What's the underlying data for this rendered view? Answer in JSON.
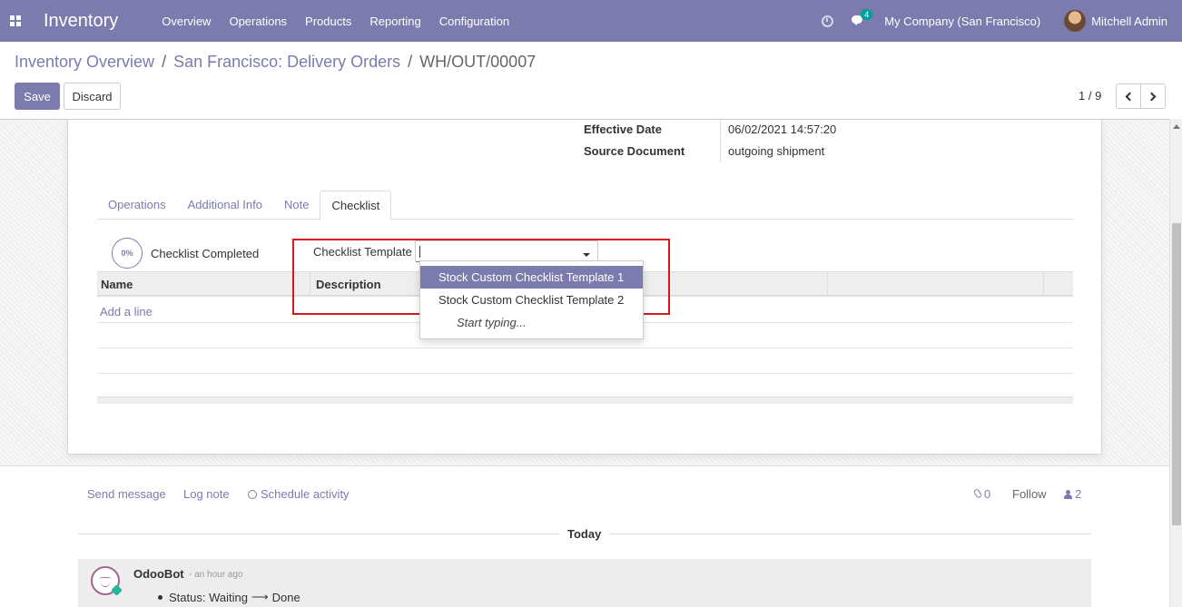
{
  "navbar": {
    "app_name": "Inventory",
    "menu": [
      "Overview",
      "Operations",
      "Products",
      "Reporting",
      "Configuration"
    ],
    "chat_badge": "4",
    "company": "My Company (San Francisco)",
    "user": "Mitchell Admin"
  },
  "breadcrumb": {
    "items": [
      "Inventory Overview",
      "San Francisco: Delivery Orders"
    ],
    "separator": "/",
    "current": "WH/OUT/00007"
  },
  "buttons": {
    "save": "Save",
    "discard": "Discard"
  },
  "pager": {
    "value": "1 / 9"
  },
  "fields": {
    "effective_date_label": "Effective Date",
    "effective_date_value": "06/02/2021 14:57:20",
    "source_document_label": "Source Document",
    "source_document_value": "outgoing shipment"
  },
  "tabs": [
    {
      "label": "Operations",
      "active": false
    },
    {
      "label": "Additional Info",
      "active": false
    },
    {
      "label": "Note",
      "active": false
    },
    {
      "label": "Checklist",
      "active": true
    }
  ],
  "checklist": {
    "progress": "0%",
    "progress_label": "Checklist Completed",
    "template_label": "Checklist Template",
    "template_value": "",
    "columns": [
      "Name",
      "Description"
    ],
    "add_line": "Add a line"
  },
  "dropdown": {
    "options": [
      "Stock Custom Checklist Template 1",
      "Stock Custom Checklist Template 2"
    ],
    "selected_index": 0,
    "hint": "Start typing..."
  },
  "chatter": {
    "send_message": "Send message",
    "log_note": "Log note",
    "schedule_activity": "Schedule activity",
    "attachments": "0",
    "follow": "Follow",
    "followers": "2",
    "date_separator": "Today",
    "message": {
      "author": "OdooBot",
      "date": "- an hour ago",
      "status_prefix": "Status: Waiting",
      "arrow": "⟶",
      "status_suffix": "Done"
    }
  },
  "colors": {
    "brand": "#7c7bad",
    "highlight": "#d9161c",
    "badge": "#00a09d"
  }
}
